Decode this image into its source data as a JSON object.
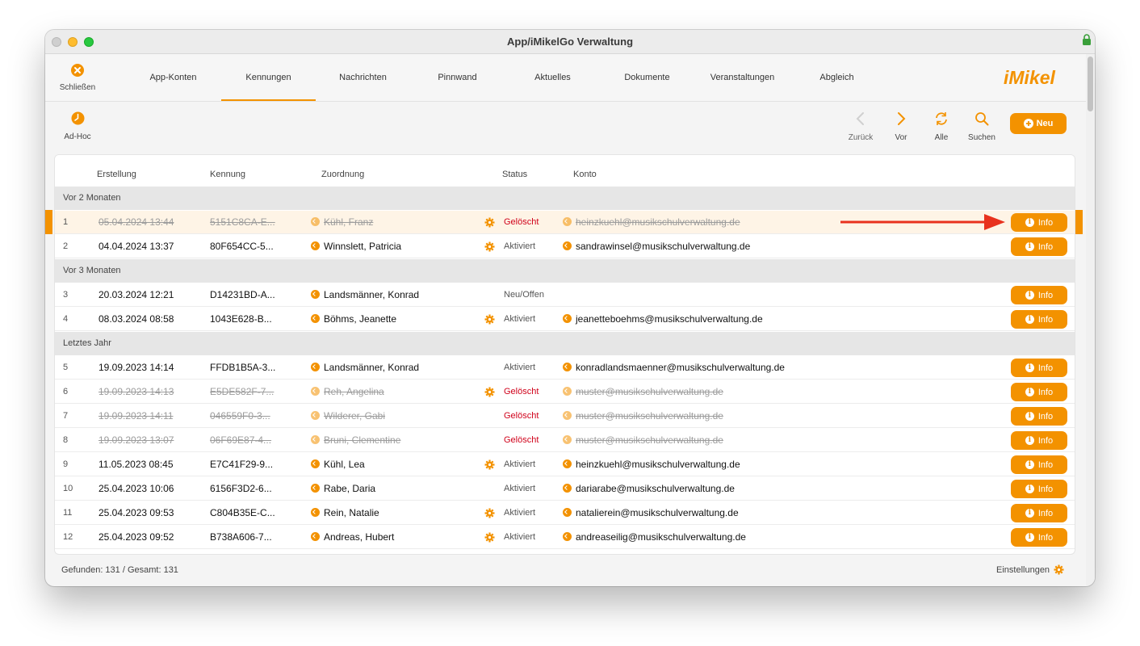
{
  "window": {
    "title": "App/iMikelGo Verwaltung"
  },
  "nav": {
    "close_label": "Schließen",
    "tabs": [
      {
        "label": "App-Konten"
      },
      {
        "label": "Kennungen"
      },
      {
        "label": "Nachrichten"
      },
      {
        "label": "Pinnwand"
      },
      {
        "label": "Aktuelles"
      },
      {
        "label": "Dokumente"
      },
      {
        "label": "Veranstaltungen"
      },
      {
        "label": "Abgleich"
      }
    ],
    "active_tab": "Kennungen",
    "logo_text": "iMikel"
  },
  "toolbar": {
    "adhoc_label": "Ad-Hoc",
    "back_label": "Zurück",
    "forward_label": "Vor",
    "all_label": "Alle",
    "search_label": "Suchen",
    "new_label": "Neu"
  },
  "table": {
    "columns": {
      "created": "Erstellung",
      "id": "Kennung",
      "assignment": "Zuordnung",
      "status": "Status",
      "account": "Konto"
    },
    "groups": [
      {
        "label": "Vor 2 Monaten"
      },
      {
        "label": "Vor 3 Monaten"
      },
      {
        "label": "Letztes Jahr"
      }
    ],
    "info_label": "Info",
    "rows": [
      {
        "num": "1",
        "created": "05.04.2024 13:44",
        "id": "5151C8CA-E...",
        "name": "Kühl, Franz",
        "status": "Gelöscht",
        "account": "heinzkuehl@musikschulverwaltung.de",
        "gear": true
      },
      {
        "num": "2",
        "created": "04.04.2024 13:37",
        "id": "80F654CC-5...",
        "name": "Winnslett, Patricia",
        "status": "Aktiviert",
        "account": "sandrawinsel@musikschulverwaltung.de",
        "gear": true
      },
      {
        "num": "3",
        "created": "20.03.2024 12:21",
        "id": "D14231BD-A...",
        "name": "Landsmänner, Konrad",
        "status": "Neu/Offen",
        "account": "",
        "gear": false
      },
      {
        "num": "4",
        "created": "08.03.2024 08:58",
        "id": "1043E628-B...",
        "name": "Böhms, Jeanette",
        "status": "Aktiviert",
        "account": "jeanetteboehms@musikschulverwaltung.de",
        "gear": true
      },
      {
        "num": "5",
        "created": "19.09.2023 14:14",
        "id": "FFDB1B5A-3...",
        "name": "Landsmänner, Konrad",
        "status": "Aktiviert",
        "account": "konradlandsmaenner@musikschulverwaltung.de",
        "gear": false
      },
      {
        "num": "6",
        "created": "19.09.2023 14:13",
        "id": "E5DE582F-7...",
        "name": "Reh, Angelina",
        "status": "Gelöscht",
        "account": "muster@musikschulverwaltung.de",
        "gear": true
      },
      {
        "num": "7",
        "created": "19.09.2023 14:11",
        "id": "046559F0-3...",
        "name": "Wilderer, Gabi",
        "status": "Gelöscht",
        "account": "muster@musikschulverwaltung.de",
        "gear": false
      },
      {
        "num": "8",
        "created": "19.09.2023 13:07",
        "id": "06F69E87-4...",
        "name": "Bruni, Clementine",
        "status": "Gelöscht",
        "account": "muster@musikschulverwaltung.de",
        "gear": false
      },
      {
        "num": "9",
        "created": "11.05.2023 08:45",
        "id": "E7C41F29-9...",
        "name": "Kühl, Lea",
        "status": "Aktiviert",
        "account": "heinzkuehl@musikschulverwaltung.de",
        "gear": true
      },
      {
        "num": "10",
        "created": "25.04.2023 10:06",
        "id": "6156F3D2-6...",
        "name": "Rabe, Daria",
        "status": "Aktiviert",
        "account": "dariarabe@musikschulverwaltung.de",
        "gear": false
      },
      {
        "num": "11",
        "created": "25.04.2023 09:53",
        "id": "C804B35E-C...",
        "name": "Rein, Natalie",
        "status": "Aktiviert",
        "account": "natalierein@musikschulverwaltung.de",
        "gear": true
      },
      {
        "num": "12",
        "created": "25.04.2023 09:52",
        "id": "B738A606-7...",
        "name": "Andreas, Hubert",
        "status": "Aktiviert",
        "account": "andreaseilig@musikschulverwaltung.de",
        "gear": true
      }
    ]
  },
  "footer": {
    "count_text": "Gefunden: 131 / Gesamt: 131",
    "settings_label": "Einstellungen"
  },
  "colors": {
    "accent": "#f39200",
    "deleted": "#d0021b",
    "arrow": "#e8321e"
  }
}
